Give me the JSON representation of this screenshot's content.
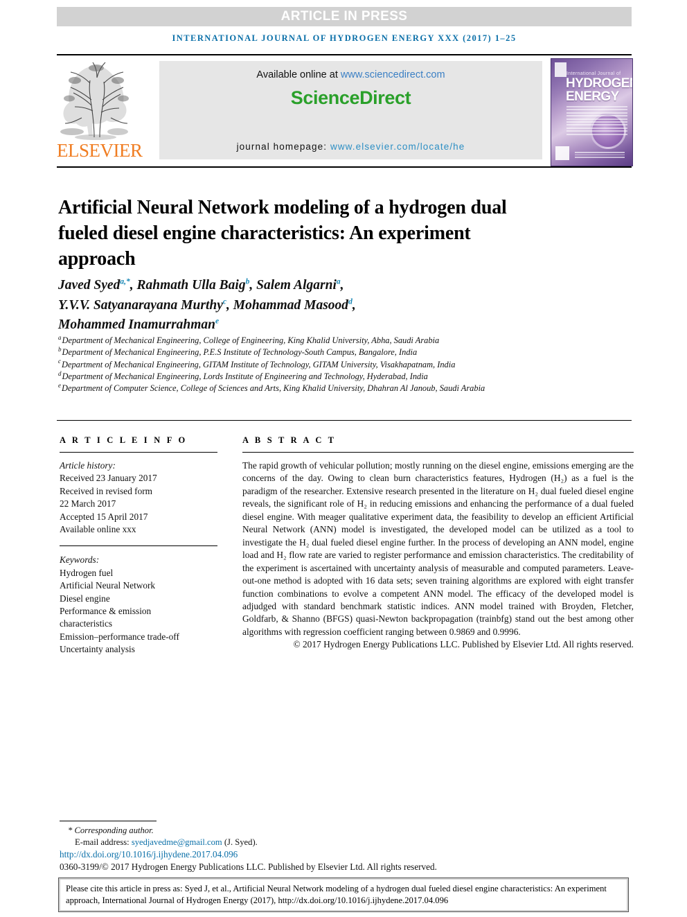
{
  "banner": {
    "text": "ARTICLE IN PRESS"
  },
  "running_header": {
    "text": "international journal of hydrogen energy xxx (2017) 1–25"
  },
  "masthead": {
    "publisher_logo_text": "ELSEVIER",
    "publisher_logo_icon": "elsevier-tree-logo",
    "available_online_label": "Available online at",
    "available_online_url": "www.sciencedirect.com",
    "sciencedirect_logo_text": "ScienceDirect",
    "journal_homepage_label": "journal homepage:",
    "journal_homepage_url": "www.elsevier.com/locate/he",
    "cover": {
      "overline": "International Journal of",
      "title_line1": "HYDROGEN",
      "title_line2": "ENERGY"
    },
    "colors": {
      "banner_gray": "#d2d2d2",
      "header_blue": "#0a6fa8",
      "sciencedirect_green": "#2aa02a",
      "elsevier_orange": "#f07d22",
      "link_blue": "#2d8fc4"
    }
  },
  "article": {
    "title": "Artificial Neural Network modeling of a hydrogen dual fueled diesel engine characteristics: An experiment approach",
    "authors_line1_prefix": "Javed Syed ",
    "authors": [
      {
        "name": "Javed Syed",
        "sup": "a,*"
      },
      {
        "name": "Rahmath Ulla Baig",
        "sup": "b"
      },
      {
        "name": "Salem Algarni",
        "sup": "a"
      },
      {
        "name": "Y.V.V. Satyanarayana Murthy",
        "sup": "c"
      },
      {
        "name": "Mohammad Masood",
        "sup": "d"
      },
      {
        "name": "Mohammed Inamurrahman",
        "sup": "e"
      }
    ],
    "affiliations": [
      {
        "marker": "a",
        "text": "Department of Mechanical Engineering, College of Engineering, King Khalid University, Abha, Saudi Arabia"
      },
      {
        "marker": "b",
        "text": "Department of Mechanical Engineering, P.E.S Institute of Technology-South Campus, Bangalore, India"
      },
      {
        "marker": "c",
        "text": "Department of Mechanical Engineering, GITAM Institute of Technology, GITAM University, Visakhapatnam, India"
      },
      {
        "marker": "d",
        "text": "Department of Mechanical Engineering, Lords Institute of Engineering and Technology, Hyderabad, India"
      },
      {
        "marker": "e",
        "text": "Department of Computer Science, College of Sciences and Arts, King Khalid University, Dhahran Al Janoub, Saudi Arabia"
      }
    ]
  },
  "article_info": {
    "section_label": "A R T I C L E   I N F O",
    "history_label": "Article history:",
    "history": [
      "Received 23 January 2017",
      "Received in revised form",
      "22 March 2017",
      "Accepted 15 April 2017",
      "Available online xxx"
    ],
    "keywords_label": "Keywords:",
    "keywords": [
      "Hydrogen fuel",
      "Artificial Neural Network",
      "Diesel engine",
      "Performance & emission",
      "characteristics",
      "Emission–performance trade-off",
      "Uncertainty analysis"
    ]
  },
  "abstract": {
    "section_label": "A B S T R A C T",
    "body": "The rapid growth of vehicular pollution; mostly running on the diesel engine, emissions emerging are the concerns of the day. Owing to clean burn characteristics features, Hydrogen (H₂) as a fuel is the paradigm of the researcher. Extensive research presented in the literature on H₂ dual fueled diesel engine reveals, the significant role of H₂ in reducing emissions and enhancing the performance of a dual fueled diesel engine. With meager qualitative experiment data, the feasibility to develop an efficient Artificial Neural Network (ANN) model is investigated, the developed model can be utilized as a tool to investigate the H₂ dual fueled diesel engine further. In the process of developing an ANN model, engine load and H₂ flow rate are varied to register performance and emission characteristics. The creditability of the experiment is ascertained with uncertainty analysis of measurable and computed parameters. Leave-out-one method is adopted with 16 data sets; seven training algorithms are explored with eight transfer function combinations to evolve a competent ANN model. The efficacy of the developed model is adjudged with standard benchmark statistic indices. ANN model trained with Broyden, Fletcher, Goldfarb, & Shanno (BFGS) quasi-Newton backpropagation (trainbfg) stand out the best among other algorithms with regression coefficient ranging between 0.9869 and 0.9996.",
    "copyright": "© 2017 Hydrogen Energy Publications LLC. Published by Elsevier Ltd. All rights reserved."
  },
  "footnote": {
    "corresponding_author": "* Corresponding author.",
    "email_label": "E-mail address:",
    "email": "syedjavedme@gmail.com",
    "email_owner": "(J. Syed).",
    "doi": "http://dx.doi.org/10.1016/j.ijhydene.2017.04.096",
    "issn_line": "0360-3199/© 2017 Hydrogen Energy Publications LLC. Published by Elsevier Ltd. All rights reserved."
  },
  "citation_box": {
    "text": "Please cite this article in press as: Syed J, et al., Artificial Neural Network modeling of a hydrogen dual fueled diesel engine characteristics: An experiment approach, International Journal of Hydrogen Energy (2017), http://dx.doi.org/10.1016/j.ijhydene.2017.04.096"
  }
}
